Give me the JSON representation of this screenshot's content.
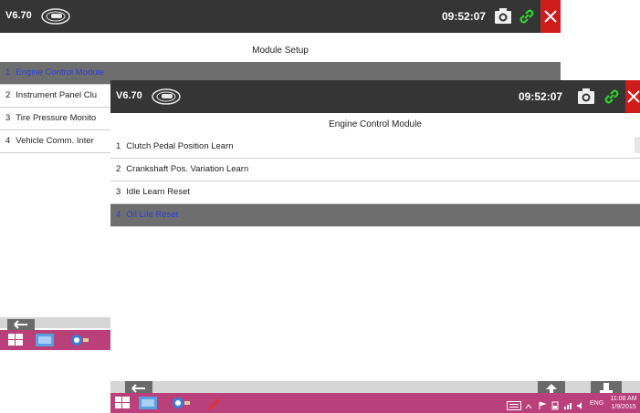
{
  "back_window": {
    "version": "V6.70",
    "clock": "09:52:07",
    "heading": "Module Setup",
    "items": [
      {
        "num": "1",
        "label": "Engine Control Module"
      },
      {
        "num": "2",
        "label": "Instrument Panel Clu"
      },
      {
        "num": "3",
        "label": "Tire Pressure Monito"
      },
      {
        "num": "4",
        "label": "Vehicle Comm. Inter"
      }
    ],
    "selected_index": 0
  },
  "front_window": {
    "version": "V6.70",
    "clock": "09:52:07",
    "heading": "Engine Control Module",
    "items": [
      {
        "num": "1",
        "label": "Clutch Pedal Position Learn"
      },
      {
        "num": "2",
        "label": "Crankshaft Pos. Variation Learn"
      },
      {
        "num": "3",
        "label": "Idle Learn Reset"
      },
      {
        "num": "4",
        "label": "Oil Life Reset"
      }
    ],
    "selected_index": 3
  },
  "taskbar": {
    "language": "ENG",
    "time": "11:08 AM",
    "date": "1/9/2015"
  },
  "icons": {
    "logo": "vehicle-logo-icon",
    "screenshot": "camera-icon",
    "connection": "link-icon",
    "close": "close-icon",
    "back": "back-arrow-icon",
    "upload": "upload-icon",
    "exit": "exit-icon"
  },
  "colors": {
    "titlebar": "#353535",
    "close": "#d01b1b",
    "link": "#2fd12f",
    "selected_row": "#6e6e6e",
    "selected_text": "#2e3fd8",
    "taskbar": "#b9407a"
  }
}
